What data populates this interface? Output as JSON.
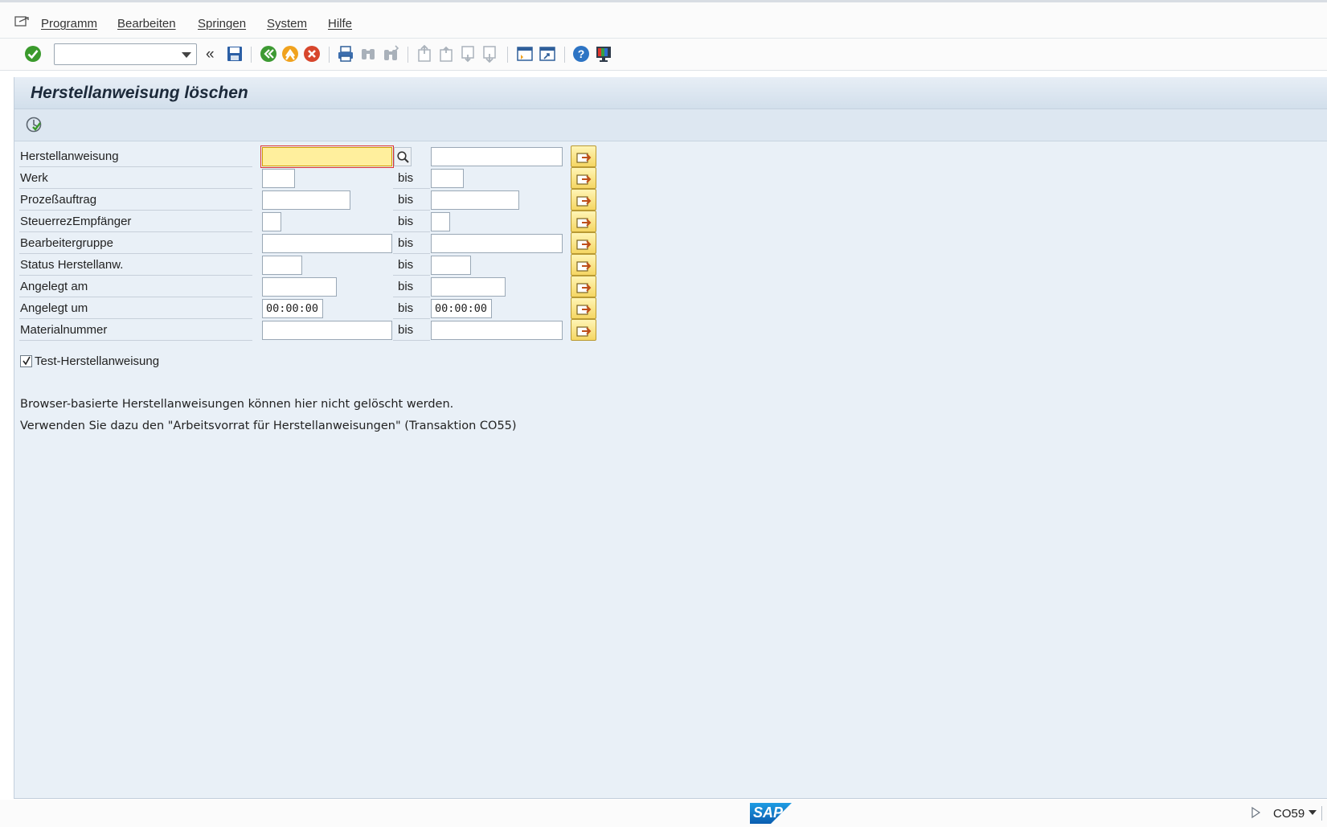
{
  "menu": {
    "items": [
      "Programm",
      "Bearbeiten",
      "Springen",
      "System",
      "Hilfe"
    ]
  },
  "toolbar": {
    "command_field_value": "",
    "icons": [
      "enter-icon",
      "save-icon",
      "back-icon",
      "exit-icon",
      "cancel-icon",
      "print-icon",
      "find-icon",
      "find-next-icon",
      "first-page-icon",
      "previous-page-icon",
      "next-page-icon",
      "last-page-icon",
      "create-session-icon",
      "shortcut-icon",
      "help-icon",
      "customize-layout-icon"
    ]
  },
  "page": {
    "title": "Herstellanweisung löschen"
  },
  "form": {
    "to_label": "bis",
    "rows": [
      {
        "label": "Herstellanweisung",
        "from": "",
        "to": ""
      },
      {
        "label": "Werk",
        "from": "",
        "to": ""
      },
      {
        "label": "Prozeßauftrag",
        "from": "",
        "to": ""
      },
      {
        "label": "SteuerrezEmpfänger",
        "from": "",
        "to": ""
      },
      {
        "label": "Bearbeitergruppe",
        "from": "",
        "to": ""
      },
      {
        "label": "Status Herstellanw.",
        "from": "",
        "to": ""
      },
      {
        "label": "Angelegt am",
        "from": "",
        "to": ""
      },
      {
        "label": "Angelegt um",
        "from": "00:00:00",
        "to": "00:00:00"
      },
      {
        "label": "Materialnummer",
        "from": "",
        "to": ""
      }
    ],
    "test_checkbox": {
      "label": "Test-Herstellanweisung",
      "checked": true
    }
  },
  "info": {
    "line1": "Browser-basierte Herstellanweisungen können hier nicht gelöscht werden.",
    "line2": "Verwenden Sie dazu den \"Arbeitsvorrat für Herstellanweisungen\" (Transaktion CO55)"
  },
  "status": {
    "logo_text": "SAP",
    "transaction": "CO59"
  }
}
